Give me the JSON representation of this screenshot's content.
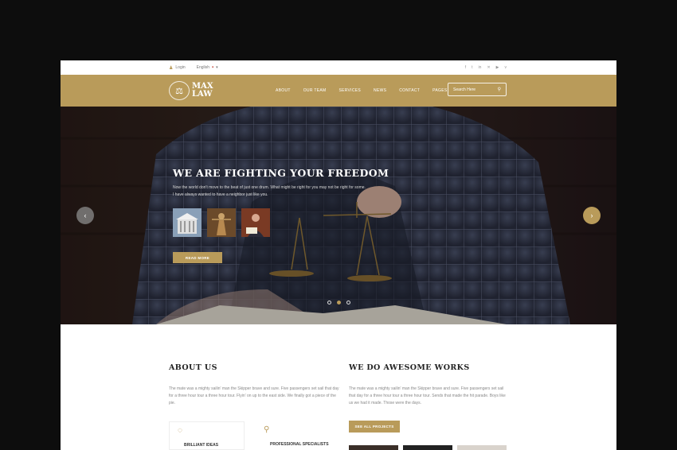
{
  "topbar": {
    "login_label": "Login",
    "language_label": "English",
    "social_icons": [
      "facebook-icon",
      "twitter-icon",
      "linkedin-icon",
      "xing-icon",
      "youtube-icon",
      "vimeo-icon"
    ],
    "social_glyphs": [
      "f",
      "t",
      "in",
      "✕",
      "▶",
      "v"
    ]
  },
  "header": {
    "logo_line1": "MAX",
    "logo_line2": "LAW",
    "nav": [
      "ABOUT",
      "OUR TEAM",
      "SERVICES",
      "NEWS",
      "CONTACT",
      "PAGES"
    ],
    "search_placeholder": "Search Here"
  },
  "hero": {
    "title": "WE ARE FIGHTING YOUR FREEDOM",
    "text": "Now the world don't move to the beat of just one drum. What might be right for you may not be right for some. I have always wanted to have a neighbor just like you.",
    "read_more": "READ MORE",
    "slide_count": 3,
    "active_slide": 1
  },
  "about": {
    "heading": "ABOUT US",
    "text": "The mate was a mighty sailin' man the Skipper brave and sure. Five passengers set sail that day for a three hour tour a three hour tour. Flyin' on up to the east side. We finally got a piece of the pie.",
    "features": [
      {
        "icon": "lightbulb-icon",
        "label": "BRILLIANT IDEAS"
      },
      {
        "icon": "user-icon",
        "label": "PROFESSIONAL SPECIALISTS"
      }
    ]
  },
  "works": {
    "heading": "WE DO AWESOME WORKS",
    "text": "The mate was a mighty sailin' man the Skipper brave and sure. Five passengers set sail that day for a three hour tour a three hour tour. Sends that made the hit parade. Boys like us we had it made. Those were the days.",
    "button": "SEE ALL PROJECTS"
  },
  "colors": {
    "accent": "#b99b5a",
    "background": "#0d0d0d"
  }
}
